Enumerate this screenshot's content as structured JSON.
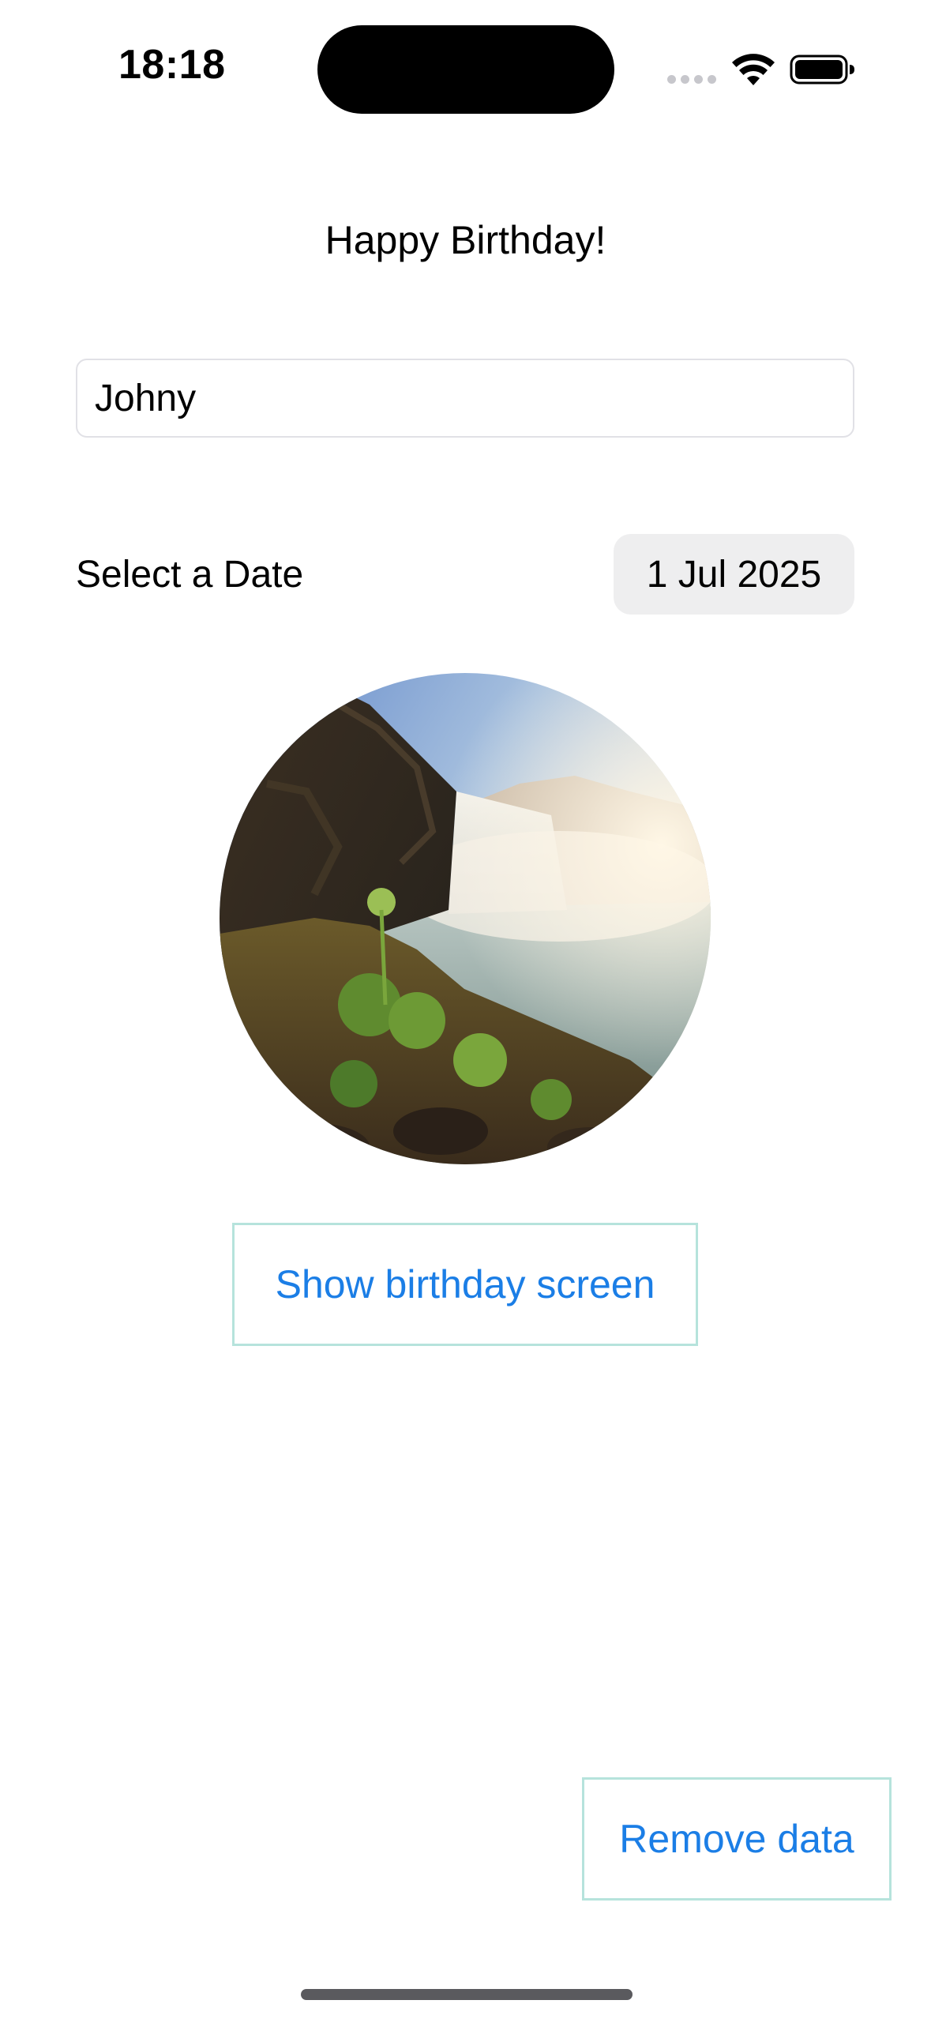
{
  "status_bar": {
    "time": "18:18",
    "icons": [
      "signal-dots-icon",
      "wifi-icon",
      "battery-icon"
    ]
  },
  "screen": {
    "title": "Happy Birthday!",
    "name_field": {
      "value": "Johny",
      "placeholder": ""
    },
    "date": {
      "label": "Select a Date",
      "value": "1 Jul 2025"
    },
    "photo": {
      "alt": "waterfall photo"
    },
    "show_button_label": "Show birthday screen",
    "remove_button_label": "Remove data"
  },
  "colors": {
    "accent": "#1b7ee6",
    "button_border": "#b6e3dc",
    "date_chip_bg": "#eeeeef",
    "field_border": "#e1e1e6"
  }
}
